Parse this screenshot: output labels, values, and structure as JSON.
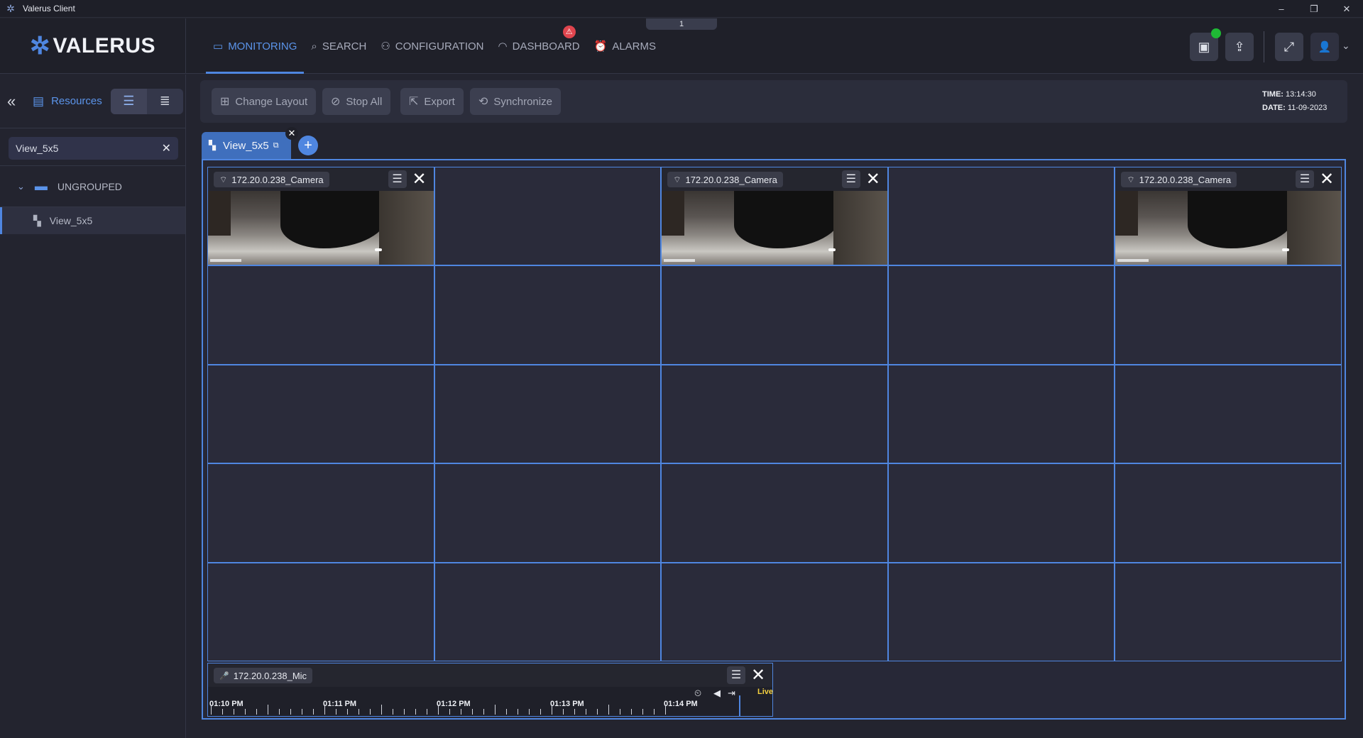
{
  "window": {
    "title": "Valerus Client",
    "minimize": "–",
    "restore": "❐",
    "close": "✕"
  },
  "brand": {
    "name": "VALERUS",
    "mark": "✲"
  },
  "page_indicator": "1",
  "nav": {
    "items": [
      {
        "label": "MONITORING",
        "icon": "monitor-icon",
        "glyph": "▭"
      },
      {
        "label": "SEARCH",
        "icon": "search-icon",
        "glyph": "⌕"
      },
      {
        "label": "CONFIGURATION",
        "icon": "configuration-icon",
        "glyph": "⚇"
      },
      {
        "label": "DASHBOARD",
        "icon": "dashboard-icon",
        "glyph": "◠"
      },
      {
        "label": "ALARMS",
        "icon": "alarm-icon",
        "glyph": "⏰"
      }
    ],
    "dashboard_badge": "⚠"
  },
  "top_actions": {
    "screen": "▣",
    "share": "⇪",
    "fullscreen": "⤢",
    "user": "👤",
    "caret": "⌄"
  },
  "sidebar": {
    "collapse": "«",
    "resources_icon": "▤",
    "resources_label": "Resources",
    "tree_view": "☰",
    "list_view": "≣",
    "search_value": "View_5x5",
    "search_clear": "✕",
    "group": {
      "chevron": "⌄",
      "icon": "▬",
      "label": "UNGROUPED"
    },
    "item": {
      "icon": "▚",
      "label": "View_5x5"
    }
  },
  "toolbar": {
    "change_layout": {
      "icon": "⊞",
      "label": "Change Layout"
    },
    "stop_all": {
      "icon": "⊘",
      "label": "Stop All"
    },
    "export": {
      "icon": "⇱",
      "label": "Export"
    },
    "synchronize": {
      "icon": "⟲",
      "label": "Synchronize"
    },
    "time_label": "TIME:",
    "time_value": "13:14:30",
    "date_label": "DATE:",
    "date_value": "11-09-2023"
  },
  "view_tab": {
    "icon": "▚",
    "label": "View_5x5",
    "popout": "⧉",
    "close": "✕",
    "add": "+"
  },
  "cameras": {
    "icon": "⌔",
    "name": "172.20.0.238_Camera",
    "menu": "☰",
    "close": "✕"
  },
  "mic": {
    "icon": "🎤",
    "name": "172.20.0.238_Mic",
    "menu": "☰",
    "close": "✕",
    "timeline_labels": [
      "01:10 PM",
      "01:11 PM",
      "01:12 PM",
      "01:13 PM",
      "01:14 PM"
    ],
    "controls": {
      "history": "⏲",
      "back": "◀",
      "jump": "⇥"
    },
    "live": "Live"
  },
  "colors": {
    "accent": "#4f86e0",
    "background": "#23242f",
    "live": "#f4d03f",
    "badge": "#e0454e",
    "status_green": "#1fb935"
  }
}
